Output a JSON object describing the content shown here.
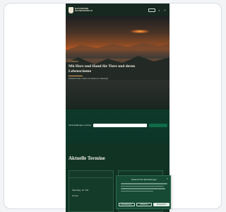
{
  "header": {
    "logo_line1": "NATURPARK",
    "logo_line2": "SCHWARZWALD",
    "action_button": "",
    "icons": [
      "search-icon",
      "menu-icon"
    ]
  },
  "hero": {
    "eyebrow": "Erleben",
    "title": "Mit Herz und Hand für Tiere und deren Lebensräume",
    "subtitle": "Entdecke Natur, Kultur und Genuss im Naturpark"
  },
  "search": {
    "label": "Veranstaltungen suchen",
    "placeholder": "",
    "button": ""
  },
  "events": {
    "title": "Aktuelle Termine",
    "cards": [
      {
        "head": "",
        "date": "Samstag, 12. Okt.",
        "time": "10 Uhr"
      },
      {
        "head": "",
        "date": "",
        "time": ""
      }
    ]
  },
  "cookie": {
    "title": "Datenschutz-Einstellungen",
    "buttons": [
      "Einstellungen",
      "Ablehnen",
      "Akzeptieren"
    ]
  },
  "colors": {
    "page_bg": "#0f2a1f",
    "accent": "#e4a65e",
    "cookie_bg": "#164a35"
  }
}
